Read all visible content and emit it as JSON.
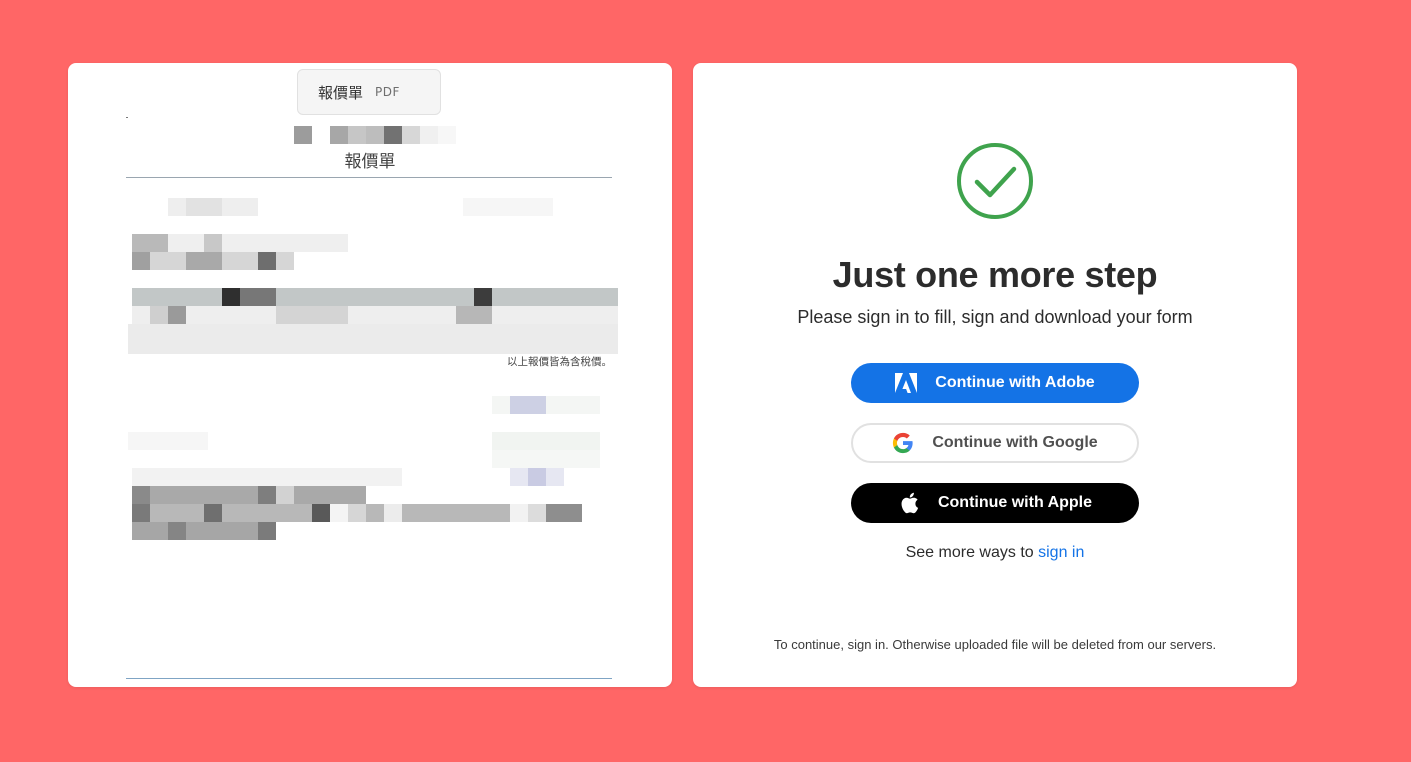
{
  "preview": {
    "file_name": "報價單",
    "file_type": "PDF",
    "doc_title": "報價單",
    "doc_note": "以上報價皆為含稅價。"
  },
  "signin": {
    "success_icon": "check-circle-icon",
    "heading": "Just one more step",
    "subheading": "Please sign in to fill, sign and download your form",
    "buttons": {
      "adobe": "Continue with Adobe",
      "google": "Continue with Google",
      "apple": "Continue with Apple"
    },
    "more_ways_prefix": "See more ways to",
    "more_ways_link": "sign in",
    "footer_note": "To continue, sign in. Otherwise uploaded file will be deleted from our servers."
  },
  "colors": {
    "background": "#ff6666",
    "adobe_blue": "#1473e6",
    "success_green": "#3fa34d",
    "apple_black": "#000000"
  }
}
